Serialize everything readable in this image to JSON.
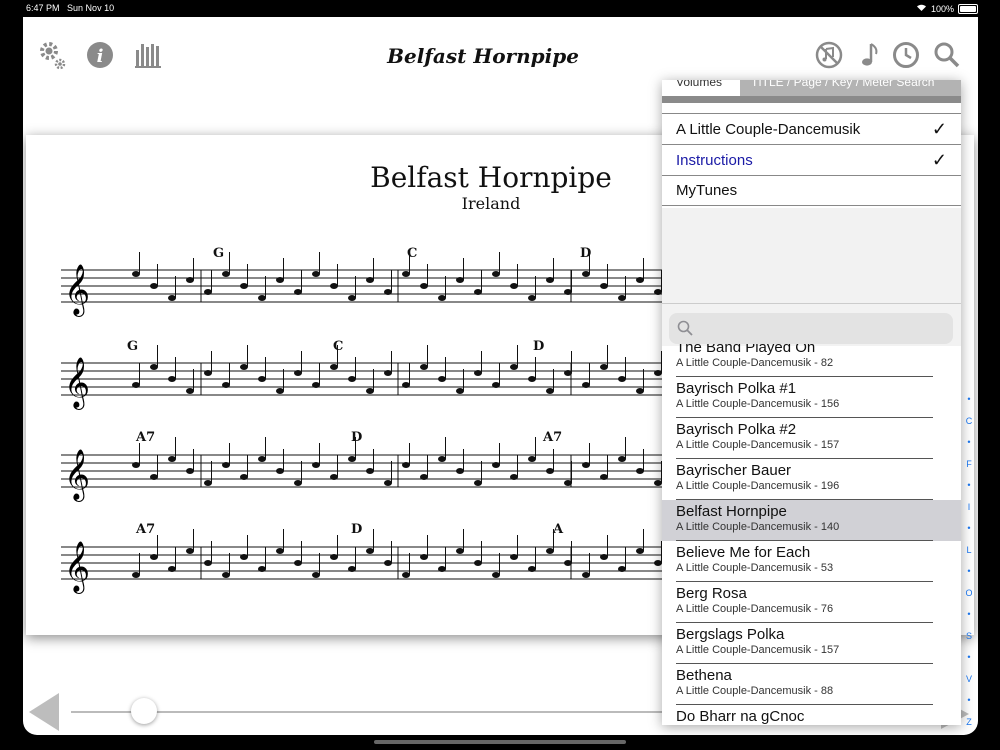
{
  "status": {
    "time": "6:47 PM",
    "date": "Sun Nov 10",
    "battery": "100%"
  },
  "toolbar": {
    "title": "Belfast Hornpipe",
    "icons": [
      "gear-icon",
      "info-icon",
      "library-icon",
      "no-sound-icon",
      "music-note-icon",
      "history-icon",
      "search-icon"
    ]
  },
  "sheet": {
    "title": "Belfast Hornpipe",
    "subtitle": "Ireland",
    "chords": {
      "line1": [
        "G",
        "C",
        "D"
      ],
      "line2": [
        "G",
        "C",
        "D"
      ],
      "line3": [
        "A7",
        "D",
        "A7"
      ],
      "line4": [
        "A7",
        "D",
        "A"
      ]
    }
  },
  "panel": {
    "tab_volumes": "Volumes",
    "tab_search": "TITLE / Page / Key / Meter Search",
    "volumes": [
      {
        "label": "A Little Couple-Dancemusik",
        "checked": true,
        "color": "#111111"
      },
      {
        "label": "Instructions",
        "checked": true,
        "color": "#1a1aa6"
      },
      {
        "label": "MyTunes",
        "checked": false,
        "color": "#111111"
      }
    ],
    "checkmark": "✓",
    "search_placeholder": "",
    "tunes": [
      {
        "title": "The Band Played On",
        "sub": "A Little Couple-Dancemusik - 82"
      },
      {
        "title": "Bayrisch Polka #1",
        "sub": "A Little Couple-Dancemusik - 156"
      },
      {
        "title": "Bayrisch Polka #2",
        "sub": "A Little Couple-Dancemusik - 157"
      },
      {
        "title": "Bayrischer Bauer",
        "sub": "A Little Couple-Dancemusik - 196"
      },
      {
        "title": "Belfast Hornpipe",
        "sub": "A Little Couple-Dancemusik - 140",
        "selected": true
      },
      {
        "title": "Believe Me for Each",
        "sub": "A Little Couple-Dancemusik - 53"
      },
      {
        "title": "Berg Rosa",
        "sub": "A Little Couple-Dancemusik - 76"
      },
      {
        "title": "Bergslags Polka",
        "sub": "A Little Couple-Dancemusik - 157"
      },
      {
        "title": "Bethena",
        "sub": "A Little Couple-Dancemusik - 88"
      },
      {
        "title": "Do Bharr na gCnoc",
        "sub": ""
      }
    ],
    "index": [
      "•",
      "C",
      "•",
      "F",
      "•",
      "I",
      "•",
      "L",
      "•",
      "O",
      "•",
      "S",
      "•",
      "V",
      "•",
      "Z"
    ]
  },
  "slider": {
    "position": 0.12
  }
}
